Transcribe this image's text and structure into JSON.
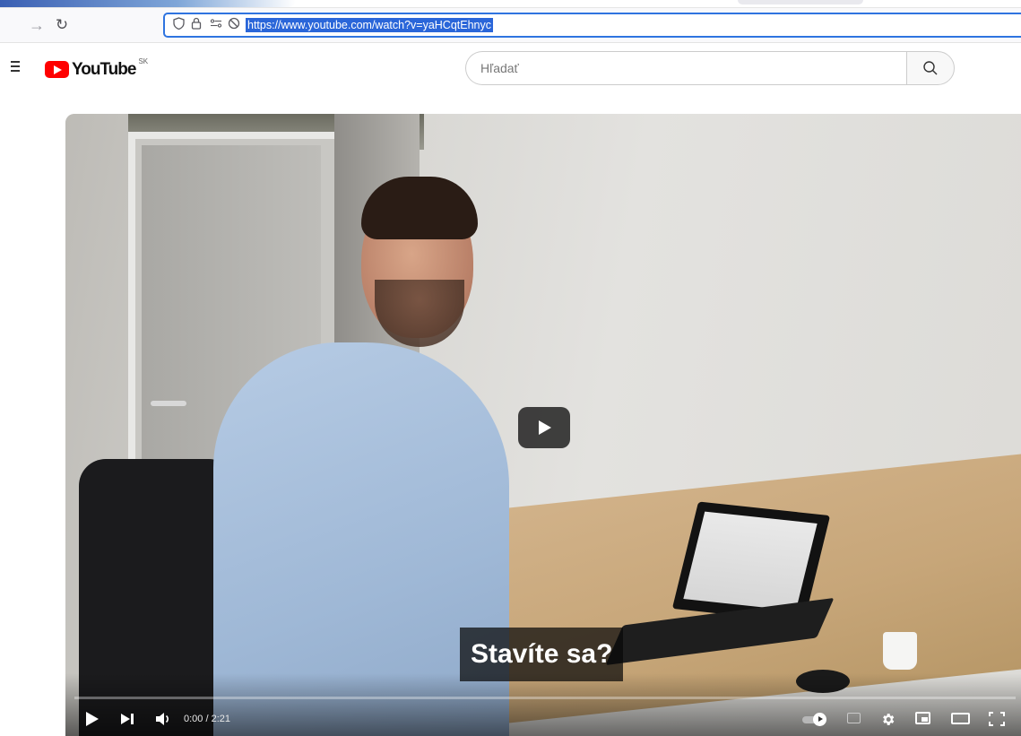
{
  "browser": {
    "url": "https://www.youtube.com/watch?v=yaHCqtEhnyc",
    "nav": {
      "forward_icon": "arrow-right-icon",
      "reload_icon": "reload-icon"
    },
    "url_icons": [
      "shield-icon",
      "lock-icon",
      "permissions-icon",
      "tracking-protection-icon"
    ]
  },
  "youtube": {
    "logo": {
      "wordmark": "YouTube",
      "region": "SK"
    },
    "search": {
      "placeholder": "Hľadať",
      "button_icon": "search-icon"
    },
    "colors": {
      "brand_red": "#ff0000",
      "url_highlight": "#2a66d9",
      "url_focus_border": "#2f74e0"
    }
  },
  "player": {
    "caption": "Stavíte sa?",
    "time": "0:00 / 2:21",
    "progress": 0,
    "controls": [
      "play-icon",
      "next-icon",
      "volume-icon",
      "autoplay-toggle-icon",
      "subtitles-icon",
      "settings-gear-icon",
      "miniplayer-icon",
      "theater-mode-icon",
      "fullscreen-icon"
    ]
  }
}
